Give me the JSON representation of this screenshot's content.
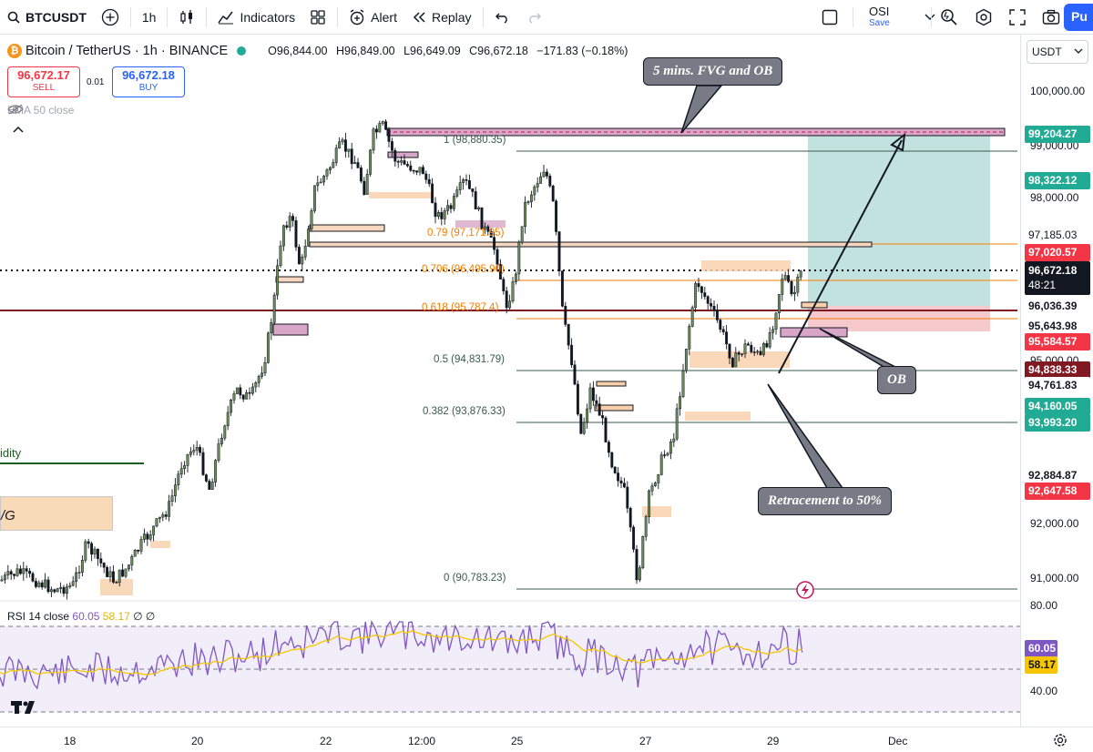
{
  "toolbar": {
    "symbol": "BTCUSDT",
    "interval": "1h",
    "indicators_label": "Indicators",
    "alert_label": "Alert",
    "replay_label": "Replay",
    "layout_name": "OSI",
    "layout_save": "Save",
    "publish_label": "Pu"
  },
  "legend": {
    "title": "Bitcoin / TetherUS · 1h · BINANCE",
    "open": "O96,844.00",
    "high": "H96,849.00",
    "low": "L96,649.09",
    "close": "C96,672.18",
    "change": "−171.83 (−0.18%)",
    "sell_price": "96,672.17",
    "sell_label": "SELL",
    "spread": "0.01",
    "buy_price": "96,672.18",
    "buy_label": "BUY",
    "ema": "EMA 50 close"
  },
  "annotations": {
    "fvg_ob": "5 mins. FVG and OB",
    "ob": "OB",
    "retracement": "Retracement to 50%",
    "liquidity_fragment": "idity",
    "fvg_fragment": "/G"
  },
  "fib_levels": {
    "l1": "1 (98,880.35)",
    "l079": "0.79 (97,171.95)",
    "l0706": "0.706 (96,495.90)",
    "l0618": "0.618 (95,787.4)",
    "l05": "0.5 (94,831.79)",
    "l0382": "0.382 (93,876.33)",
    "l0": "0 (90,783.23)"
  },
  "rsi": {
    "label": "RSI 14 close",
    "value": "60.05",
    "ma": "58.17",
    "extra": "∅ ∅"
  },
  "price_scale": {
    "currency": "USDT",
    "ticks": [
      "100,000.00",
      "99,000.00",
      "98,000.00",
      "95,000.00",
      "92,000.00",
      "91,000.00",
      "80.00",
      "40.00"
    ],
    "tags": {
      "t1": "99,204.27",
      "t2": "98,322.12",
      "t3": "97,185.03",
      "t4": "97,020.57",
      "t5": "96,672.18",
      "t5b": "48:21",
      "t6": "96,036.39",
      "t7": "95,643.98",
      "t8": "95,584.57",
      "t9": "94,838.33",
      "t10": "94,761.83",
      "t11": "94,160.05",
      "t12": "93,993.20",
      "t13": "92,884.87",
      "t14": "92,647.58",
      "rsi_v": "60.05",
      "rsi_ma": "58.17"
    },
    "colors": {
      "green": "#22ab94",
      "red": "#f23645",
      "dark_red": "#801922",
      "black": "#131722",
      "purple": "#7e57c2",
      "yellow": "#f7c600"
    }
  },
  "time_axis": [
    "18",
    "20",
    "22",
    "12:00",
    "25",
    "27",
    "29",
    "Dec"
  ]
}
